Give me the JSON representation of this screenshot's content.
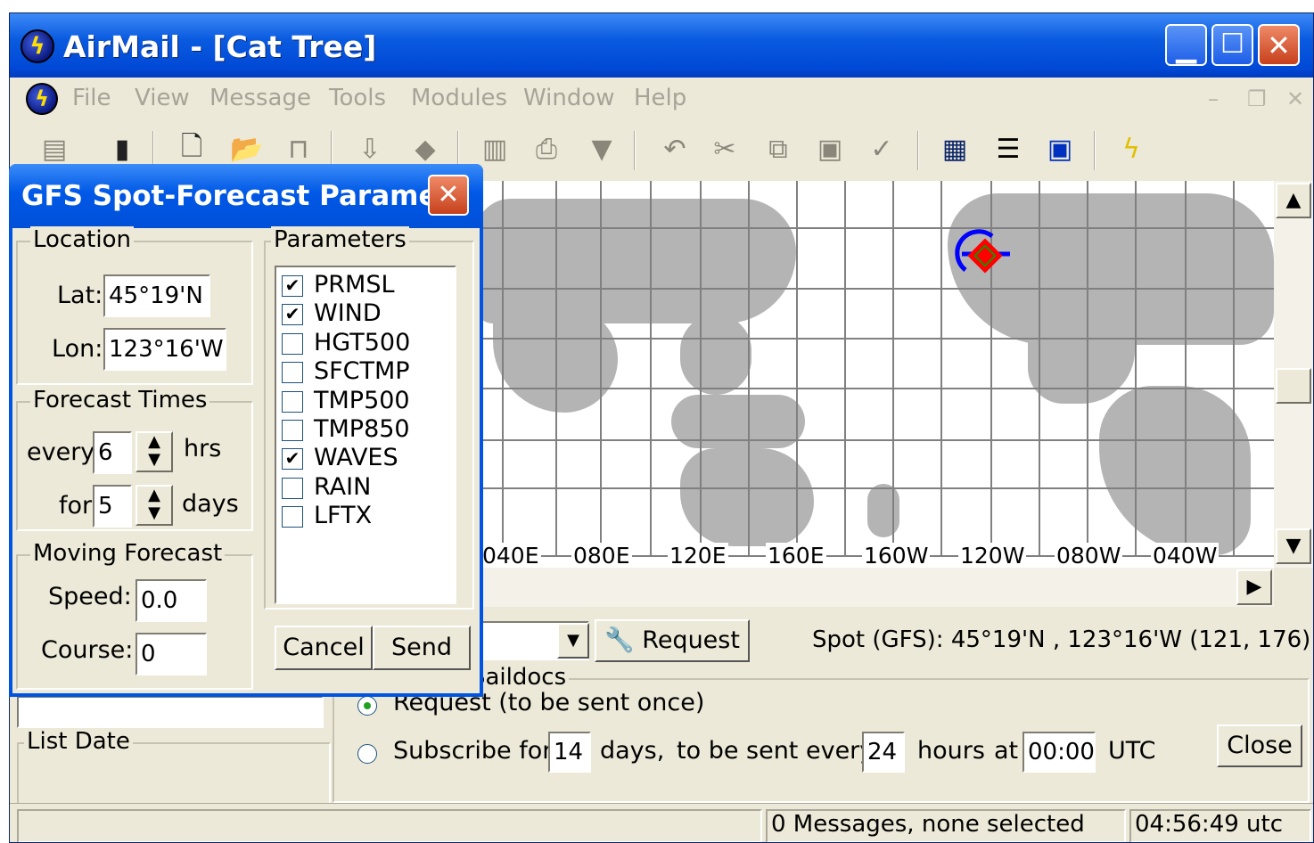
{
  "window": {
    "title": "AirMail - [Cat Tree]"
  },
  "menu": [
    "File",
    "View",
    "Message",
    "Tools",
    "Modules",
    "Window",
    "Help"
  ],
  "mdi_controls": [
    "–",
    "❐",
    "✕"
  ],
  "map": {
    "longitude_labels": [
      "040E",
      "080E",
      "120E",
      "160E",
      "160W",
      "120W",
      "080W",
      "040W"
    ],
    "marker": "forecast-spot"
  },
  "request_bar": {
    "request_label": "Request",
    "spot_text": "Spot (GFS): 45°19'N , 123°16'W (121, 176)"
  },
  "saildocs": {
    "group_title": "Saildocs",
    "request_once_label": "Request (to be sent once)",
    "request_once_selected": true,
    "subscribe_label": "Subscribe for",
    "subscribe_days": "14",
    "days_label": "days,",
    "every_label": "to be sent every",
    "every_hours": "24",
    "hours_label": "hours",
    "at_label": "at",
    "time": "00:00",
    "utc_label": "UTC",
    "close_label": "Close"
  },
  "left_panel": {
    "list_date_title": "List Date"
  },
  "status": {
    "messages": "0 Messages, none selected",
    "clock": "04:56:49 utc"
  },
  "dialog": {
    "title": "GFS Spot-Forecast Parame...",
    "close_icon": "✕",
    "location": {
      "title": "Location",
      "lat_label": "Lat:",
      "lat": "45°19'N",
      "lon_label": "Lon:",
      "lon": "123°16'W"
    },
    "forecast_times": {
      "title": "Forecast Times",
      "every_label": "every",
      "every": "6",
      "hrs_label": "hrs",
      "for_label": "for",
      "for": "5",
      "days_label": "days"
    },
    "moving": {
      "title": "Moving Forecast",
      "speed_label": "Speed:",
      "speed": "0.0",
      "course_label": "Course:",
      "course": "0"
    },
    "parameters": {
      "title": "Parameters",
      "items": [
        {
          "label": "PRMSL",
          "checked": true
        },
        {
          "label": "WIND",
          "checked": true
        },
        {
          "label": "HGT500",
          "checked": false
        },
        {
          "label": "SFCTMP",
          "checked": false
        },
        {
          "label": "TMP500",
          "checked": false
        },
        {
          "label": "TMP850",
          "checked": false
        },
        {
          "label": "WAVES",
          "checked": true
        },
        {
          "label": "RAIN",
          "checked": false
        },
        {
          "label": "LFTX",
          "checked": false
        }
      ]
    },
    "cancel_label": "Cancel",
    "send_label": "Send"
  },
  "icons": {
    "app": "airmail-globe-icon",
    "toolbar": [
      "address-book-icon",
      "book-icon",
      "new-message-icon",
      "open-folder-icon",
      "lock-icon",
      "inbox-icon",
      "attach-icon",
      "form-icon",
      "print-icon",
      "delete-icon",
      "undo-icon",
      "cut-icon",
      "copy-icon",
      "paste-icon",
      "spellcheck-icon",
      "view-list-icon",
      "view-detail-icon",
      "view-window-icon",
      "lightning-icon",
      "globe-icon"
    ]
  },
  "colors": {
    "titlebar": "#0054e3",
    "land": "#b4b4b4",
    "grid": "#808080",
    "marker_blue": "#0000ff",
    "marker_red": "#ff0000",
    "marker_green": "#00a000"
  }
}
